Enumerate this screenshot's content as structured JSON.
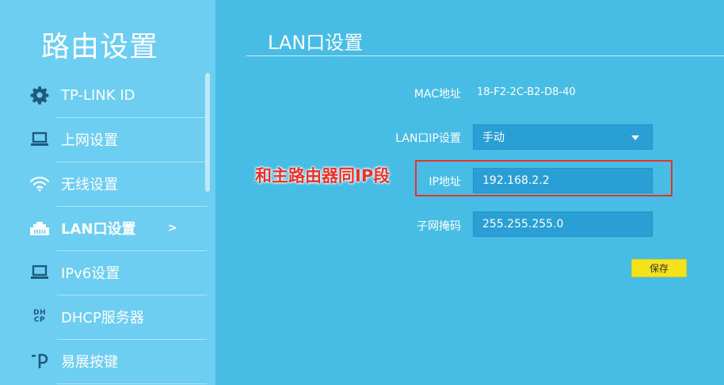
{
  "sidebar": {
    "title": "路由设置",
    "items": [
      {
        "label": "TP-LINK ID",
        "icon": "gear-icon"
      },
      {
        "label": "上网设置",
        "icon": "laptop-icon"
      },
      {
        "label": "无线设置",
        "icon": "wifi-icon"
      },
      {
        "label": "LAN口设置",
        "icon": "ethernet-port-icon",
        "active": true,
        "chevron": ">"
      },
      {
        "label": "IPv6设置",
        "icon": "laptop-icon"
      },
      {
        "label": "DHCP服务器",
        "icon": "dhcp-icon",
        "icon_text": [
          "DH",
          "CP"
        ]
      },
      {
        "label": "易展按键",
        "icon": "easy-mesh-icon"
      }
    ]
  },
  "main": {
    "title": "LAN口设置",
    "mac": {
      "label": "MAC地址",
      "value": "18-F2-2C-B2-D8-40"
    },
    "ip_mode": {
      "label": "LAN口IP设置",
      "value": "手动"
    },
    "ip_address": {
      "label": "IP地址",
      "value": "192.168.2.2"
    },
    "subnet_mask": {
      "label": "子网掩码",
      "value": "255.255.255.0"
    },
    "save_label": "保存"
  },
  "annotation": {
    "text": "和主路由器同IP段",
    "color": "#e8322c"
  },
  "colors": {
    "sidebar_bg": "#6dcef2",
    "main_bg": "#47bde6",
    "input_bg": "#2a9fd6",
    "save_button": "#f4e21b"
  }
}
